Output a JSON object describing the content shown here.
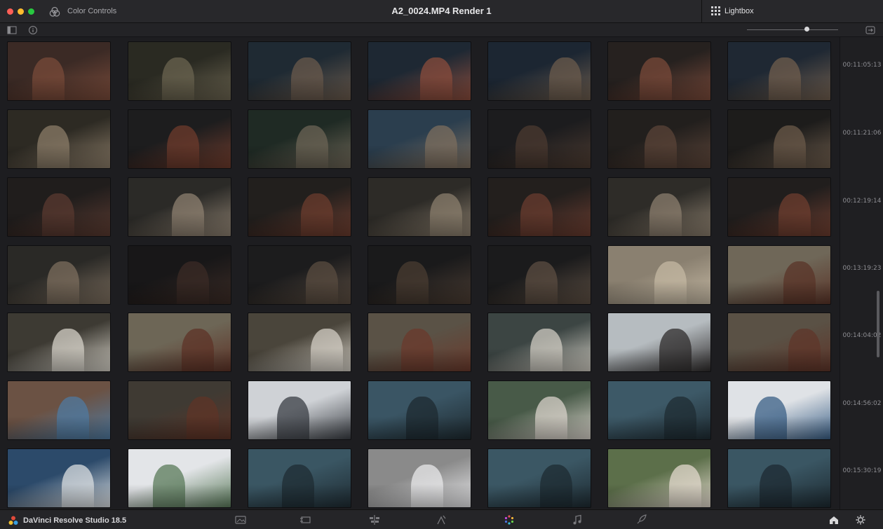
{
  "titlebar": {
    "panel_label": "Color Controls",
    "window_title": "A2_0024.MP4 Render 1",
    "lightbox_label": "Lightbox"
  },
  "toolbar": {
    "left_icons": [
      "sidebar-toggle-icon",
      "info-icon"
    ],
    "right_icons": [
      "zoom-slider",
      "exit-lightbox-icon"
    ]
  },
  "grid": {
    "rows": [
      {
        "timecode": "00:11:05:13",
        "thumbs": [
          [
            "#3b2a25",
            "#7a4b3a"
          ],
          [
            "#2a2a22",
            "#6b6450"
          ],
          [
            "#1f2a33",
            "#6a5a4c"
          ],
          [
            "#1e2833",
            "#8a4c3c"
          ],
          [
            "#1c2632",
            "#6b5b4c"
          ],
          [
            "#26211f",
            "#7a4a3a"
          ],
          [
            "#1f2833",
            "#705e4e"
          ]
        ]
      },
      {
        "timecode": "00:11:21:06",
        "thumbs": [
          [
            "#2d2a23",
            "#8b7c68"
          ],
          [
            "#1d1d1e",
            "#6e3b2c"
          ],
          [
            "#1f2a24",
            "#6c6455"
          ],
          [
            "#2b3e4e",
            "#7c6d5d"
          ],
          [
            "#1c1c1e",
            "#4b3a30"
          ],
          [
            "#221f1d",
            "#5b4438"
          ],
          [
            "#1d1c1b",
            "#6b5a4a"
          ]
        ]
      },
      {
        "timecode": "00:12:19:14",
        "thumbs": [
          [
            "#201d1c",
            "#5a3a30"
          ],
          [
            "#2b2a27",
            "#8d8070"
          ],
          [
            "#221f1d",
            "#6b3c2e"
          ],
          [
            "#2d2b27",
            "#8a7d6c"
          ],
          [
            "#231f1d",
            "#6a3c2f"
          ],
          [
            "#2e2c28",
            "#8b7e6d"
          ],
          [
            "#211e1d",
            "#6d3d2f"
          ]
        ]
      },
      {
        "timecode": "00:13:19:23",
        "thumbs": [
          [
            "#2a2926",
            "#7c6e5e"
          ],
          [
            "#181718",
            "#3b2b25"
          ],
          [
            "#1c1c1d",
            "#5a4c40"
          ],
          [
            "#1a1a1b",
            "#4a3c32"
          ],
          [
            "#1b1b1c",
            "#5c4e42"
          ],
          [
            "#8a8070",
            "#c4b8a3"
          ],
          [
            "#6f6758",
            "#5a3428"
          ]
        ]
      },
      {
        "timecode": "00:14:04:02",
        "thumbs": [
          [
            "#3d3a33",
            "#d6d2c8"
          ],
          [
            "#6d6656",
            "#5e3327"
          ],
          [
            "#4a453b",
            "#d3cec4"
          ],
          [
            "#5a5246",
            "#6b3a2c"
          ],
          [
            "#3c4543",
            "#cfcbc1"
          ],
          [
            "#b6bcc0",
            "#2f2c2c"
          ],
          [
            "#5a5145",
            "#5f3529"
          ]
        ]
      },
      {
        "timecode": "00:14:56:02",
        "thumbs": [
          [
            "#6b5244",
            "#4f7aa0"
          ],
          [
            "#3f3a33",
            "#5d3427"
          ],
          [
            "#cfd2d6",
            "#3a3e44"
          ],
          [
            "#3a5564",
            "#1e2a30"
          ],
          [
            "#485a48",
            "#d8d2ca"
          ],
          [
            "#3d5967",
            "#1f2c33"
          ],
          [
            "#dfe2e6",
            "#3a5f86"
          ]
        ]
      },
      {
        "timecode": "00:15:30:19",
        "thumbs": [
          [
            "#2c4a6a",
            "#d9dde0"
          ],
          [
            "#e3e5e8",
            "#5a7a5a"
          ],
          [
            "#3a5663",
            "#1f2c33"
          ],
          [
            "#8a8a8a",
            "#e8e8ea"
          ],
          [
            "#3b5764",
            "#1e2b32"
          ],
          [
            "#5c6f4a",
            "#e2d8cc"
          ],
          [
            "#3a5663",
            "#1d2a31"
          ]
        ]
      }
    ]
  },
  "bottombar": {
    "app_name": "DaVinci Resolve Studio 18.5",
    "pages": [
      "media-page-icon",
      "cut-page-icon",
      "edit-page-icon",
      "fusion-page-icon",
      "color-page-icon",
      "fairlight-page-icon",
      "deliver-page-icon"
    ],
    "right_icons": [
      "home-icon",
      "settings-icon"
    ]
  }
}
